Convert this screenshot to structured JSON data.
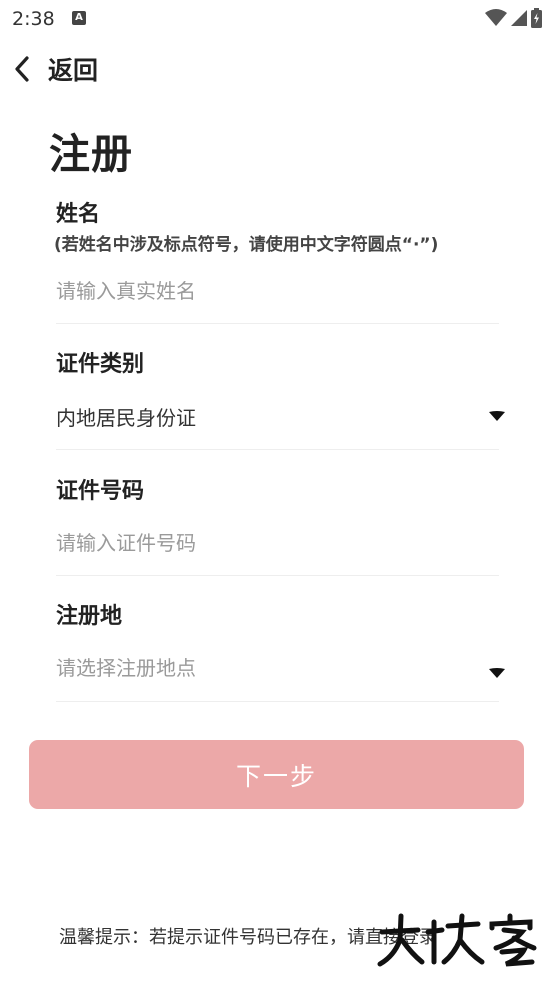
{
  "status_bar": {
    "time": "2:38",
    "app_icon_letter": "A"
  },
  "nav": {
    "back_label": "返回"
  },
  "page": {
    "title": "注册"
  },
  "form": {
    "name": {
      "label": "姓名",
      "hint": "(若姓名中涉及标点符号，请使用中文字符圆点“·”)",
      "placeholder": "请输入真实姓名"
    },
    "id_type": {
      "label": "证件类别",
      "value": "内地居民身份证"
    },
    "id_number": {
      "label": "证件号码",
      "placeholder": "请输入证件号码"
    },
    "region": {
      "label": "注册地",
      "placeholder": "请选择注册地点"
    }
  },
  "actions": {
    "next_label": "下一步"
  },
  "footer": {
    "tip": "温馨提示：若提示证件号码已存在，请直接登录"
  },
  "colors": {
    "primary_disabled": "#eca8a8",
    "divider": "#eeeeee",
    "placeholder": "#9a9a9a"
  }
}
